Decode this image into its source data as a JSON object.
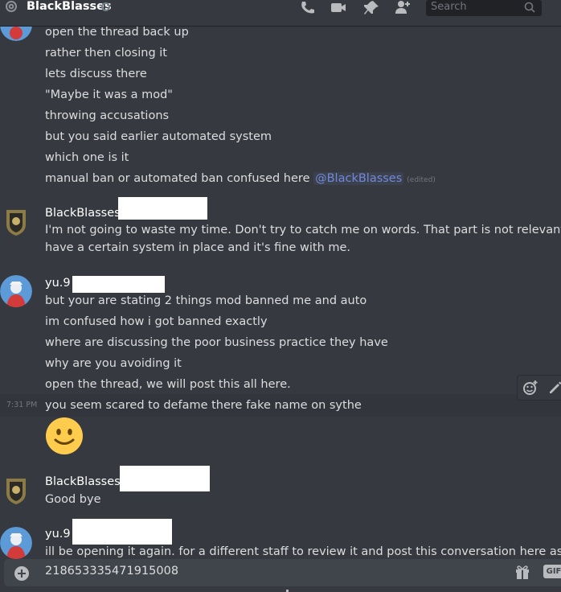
{
  "header": {
    "channel_name": "BlackBlasses",
    "search_placeholder": "Search",
    "icons": [
      "at-icon",
      "phone-call-icon",
      "video-call-icon",
      "pin-icon",
      "add-friend-icon",
      "search-icon"
    ]
  },
  "messages": {
    "top_group_lines": [
      "open the thread back up",
      "rather then closing it",
      "lets discuss there",
      "\"Maybe it was a mod\"",
      "throwing accusations",
      "but you said earlier automated system",
      "which one is it"
    ],
    "mention_line": {
      "text": "manual ban or automated ban confused here ",
      "mention": "@BlackBlasses",
      "edited": "(edited)"
    },
    "group2": {
      "username": "BlackBlasses",
      "line1": "I'm not going to waste my time. Don't try to catch me on words. That part is not relevant. They",
      "line2": "have a certain system in place and it's fine with me."
    },
    "group3": {
      "username": "yu.9",
      "lines": [
        "but your are stating 2 things mod banned me and auto",
        "im confused how i got banned exactly",
        "where are discussing the poor business practice they have",
        "why are you avoiding it",
        "open the thread, we will post this all here."
      ],
      "timestamp": "7:31 PM",
      "hover_line": "you seem scared to defame there fake name on sythe",
      "emoji": "slightly-smiling-face-emoji"
    },
    "group4": {
      "username": "BlackBlasses",
      "line": "Good bye"
    },
    "group5": {
      "username": "yu.9",
      "line": "ill be opening it again. for a different staff to review it and post this conversation here as you seem"
    }
  },
  "composer": {
    "text": "218653335471915008",
    "gif_label": "GIF"
  },
  "colors": {
    "background": "#36393f",
    "mention": "#7289da",
    "text": "#dcddde"
  }
}
